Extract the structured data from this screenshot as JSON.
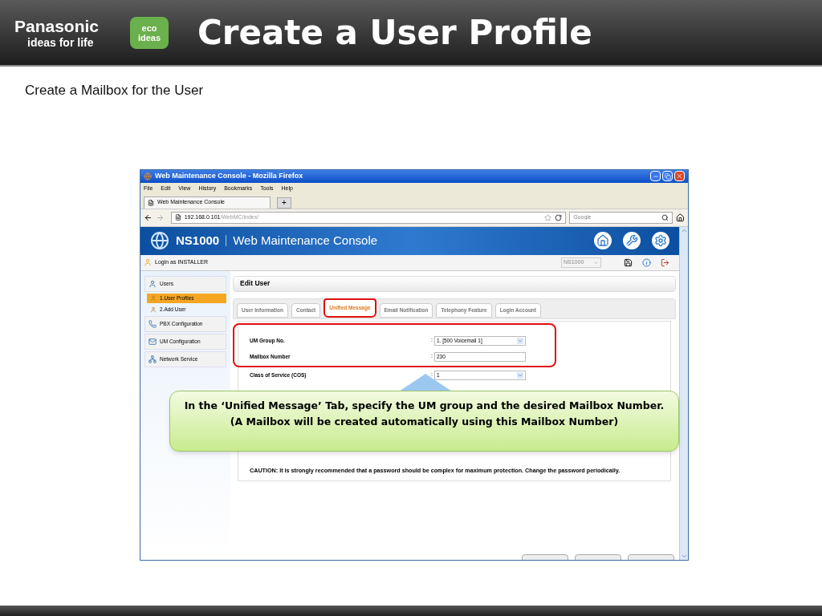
{
  "slide": {
    "logo": {
      "brand": "Panasonic",
      "tagline": "ideas for life",
      "badge_lines": [
        "eco",
        "ideas"
      ]
    },
    "title": "Create a User Profile",
    "subtitle": "Create a Mailbox for the User"
  },
  "browser": {
    "window_title": "Web Maintenance Console - Mozilla Firefox",
    "menu": [
      "File",
      "Edit",
      "View",
      "History",
      "Bookmarks",
      "Tools",
      "Help"
    ],
    "tab": "Web Maintenance Console",
    "new_tab": "+",
    "url_host": "192.168.0.101",
    "url_path": "/WebMC/index/",
    "search_placeholder": "Google"
  },
  "app": {
    "product": "NS1000",
    "name": "Web Maintenance Console",
    "login": "Login as INSTALLER",
    "site_select": "NS1000",
    "sidebar": [
      {
        "label": "Users",
        "selected": false,
        "children": [
          {
            "label": "1.User Profiles",
            "selected": true
          },
          {
            "label": "2.Add User",
            "selected": false
          }
        ]
      },
      {
        "label": "PBX Configuration",
        "selected": false
      },
      {
        "label": "UM Configuration",
        "selected": false
      },
      {
        "label": "Network Service",
        "selected": false
      }
    ],
    "page_title": "Edit User",
    "tabs": [
      {
        "label": "User Information",
        "selected": false
      },
      {
        "label": "Contact",
        "selected": false
      },
      {
        "label": "Unified Message",
        "selected": true
      },
      {
        "label": "Email Notification",
        "selected": false
      },
      {
        "label": "Telephony Feature",
        "selected": false
      },
      {
        "label": "Login Account",
        "selected": false
      }
    ],
    "form": [
      {
        "label": "UM Group No.",
        "separator": ":",
        "kind": "select",
        "value": "1. [500 Voicemail 1]",
        "highlighted": true
      },
      {
        "label": "Mailbox Number",
        "separator": ":",
        "kind": "text",
        "value": "230",
        "highlighted": true
      },
      {
        "label": "Class of Service (COS)",
        "separator": ":",
        "kind": "select",
        "value": "1",
        "highlighted": false
      }
    ],
    "caution": "CAUTION: It is strongly recommended that a password should be complex for maximum protection. Change the password periodically."
  },
  "callout": {
    "lines": [
      "In the ‘Unified Message’ Tab, specify the UM group and the desired Mailbox Number.",
      "(A Mailbox will be created automatically using this Mailbox Number)"
    ]
  }
}
